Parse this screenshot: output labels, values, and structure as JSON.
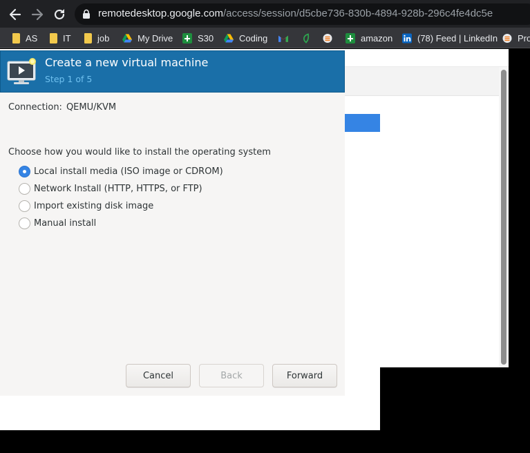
{
  "browser": {
    "url_host": "remotedesktop.google.com",
    "url_path": "/access/session/d5cbe736-830b-4894-928b-296c4fe4dc5e",
    "bookmarks": [
      {
        "label": "AS",
        "icon": "folder-icon"
      },
      {
        "label": "IT",
        "icon": "folder-icon"
      },
      {
        "label": "job",
        "icon": "folder-icon"
      },
      {
        "label": "My Drive",
        "icon": "google-drive-icon"
      },
      {
        "label": "S30",
        "icon": "google-sheets-icon"
      },
      {
        "label": "Coding",
        "icon": "google-drive-icon"
      },
      {
        "label": "",
        "icon": "gmail-icon"
      },
      {
        "label": "",
        "icon": "leaf-icon"
      },
      {
        "label": "",
        "icon": "stack-icon"
      },
      {
        "label": "amazon",
        "icon": "google-sheets-icon"
      },
      {
        "label": "(78) Feed | LinkedIn",
        "icon": "linkedin-icon"
      },
      {
        "label": "Pro",
        "icon": "stack-icon"
      }
    ]
  },
  "dialog": {
    "title": "Create a new virtual machine",
    "step": "Step 1 of 5",
    "connection_label": "Connection:",
    "connection_value": "QEMU/KVM",
    "prompt": "Choose how you would like to install the operating system",
    "options": [
      {
        "label": "Local install media (ISO image or CDROM)",
        "selected": true
      },
      {
        "label": "Network Install (HTTP, HTTPS, or FTP)",
        "selected": false
      },
      {
        "label": "Import existing disk image",
        "selected": false
      },
      {
        "label": "Manual install",
        "selected": false
      }
    ],
    "buttons": {
      "cancel": "Cancel",
      "back": "Back",
      "forward": "Forward"
    },
    "back_enabled": false
  },
  "colors": {
    "header_bg": "#1a6fa8",
    "step_text": "#6fc0ef",
    "radio_selected": "#3584e4",
    "selection_highlight": "#3584e4"
  }
}
